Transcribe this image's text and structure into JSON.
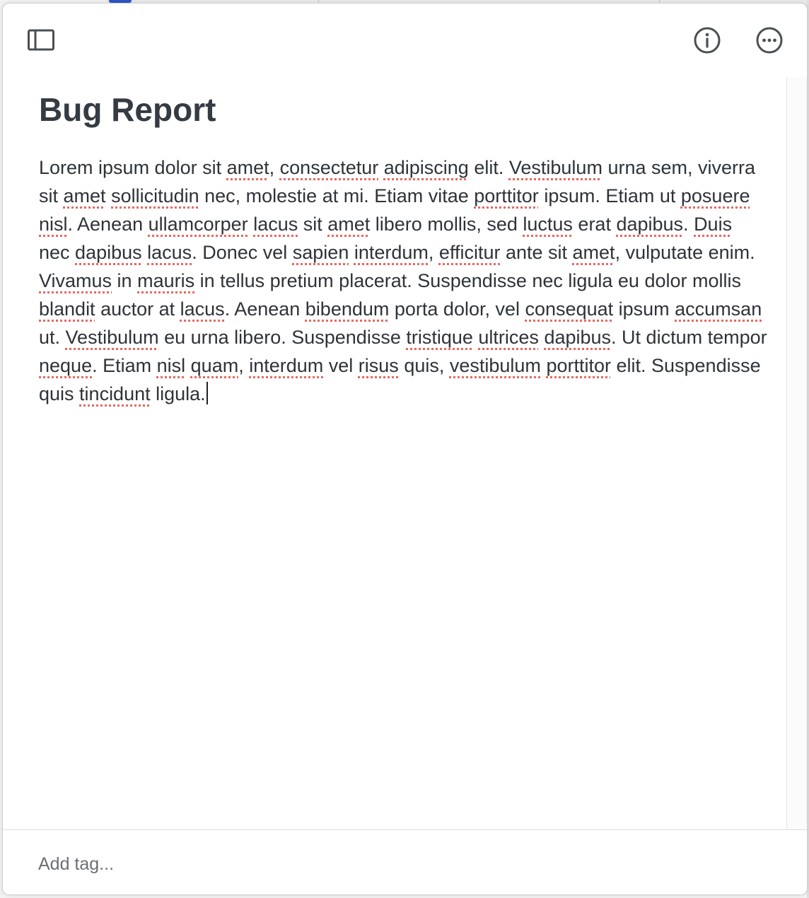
{
  "note": {
    "title": "Bug Report",
    "body_segments": [
      {
        "t": "Lorem ipsum dolor sit "
      },
      {
        "t": "amet",
        "s": true
      },
      {
        "t": ", "
      },
      {
        "t": "consectetur",
        "s": true
      },
      {
        "t": " "
      },
      {
        "t": "adipiscing",
        "s": true
      },
      {
        "t": " elit. "
      },
      {
        "t": "Vestibulum",
        "s": true
      },
      {
        "t": " urna sem, viverra sit "
      },
      {
        "t": "amet",
        "s": true
      },
      {
        "t": " "
      },
      {
        "t": "sollicitudin",
        "s": true
      },
      {
        "t": " nec, molestie at mi. Etiam vitae "
      },
      {
        "t": "porttitor",
        "s": true
      },
      {
        "t": " ipsum. Etiam ut "
      },
      {
        "t": "posuere",
        "s": true
      },
      {
        "t": " "
      },
      {
        "t": "nisl",
        "s": true
      },
      {
        "t": ". Aenean "
      },
      {
        "t": "ullamcorper",
        "s": true
      },
      {
        "t": " "
      },
      {
        "t": "lacus",
        "s": true
      },
      {
        "t": " sit "
      },
      {
        "t": "amet",
        "s": true
      },
      {
        "t": " libero mollis, sed "
      },
      {
        "t": "luctus",
        "s": true
      },
      {
        "t": " erat "
      },
      {
        "t": "dapibus",
        "s": true
      },
      {
        "t": ". "
      },
      {
        "t": "Duis",
        "s": true
      },
      {
        "t": " nec "
      },
      {
        "t": "dapibus",
        "s": true
      },
      {
        "t": " "
      },
      {
        "t": "lacus",
        "s": true
      },
      {
        "t": ". Donec vel "
      },
      {
        "t": "sapien",
        "s": true
      },
      {
        "t": " "
      },
      {
        "t": "interdum",
        "s": true
      },
      {
        "t": ", "
      },
      {
        "t": "efficitur",
        "s": true
      },
      {
        "t": " ante sit "
      },
      {
        "t": "amet",
        "s": true
      },
      {
        "t": ", vulputate enim. "
      },
      {
        "t": "Vivamus",
        "s": true
      },
      {
        "t": " in "
      },
      {
        "t": "mauris",
        "s": true
      },
      {
        "t": " in tellus pretium placerat. Suspendisse nec ligula eu dolor mollis "
      },
      {
        "t": "blandit",
        "s": true
      },
      {
        "t": " auctor at "
      },
      {
        "t": "lacus",
        "s": true
      },
      {
        "t": ". Aenean "
      },
      {
        "t": "bibendum",
        "s": true
      },
      {
        "t": " porta dolor, vel "
      },
      {
        "t": "consequat",
        "s": true
      },
      {
        "t": " ipsum "
      },
      {
        "t": "accumsan",
        "s": true
      },
      {
        "t": " ut. "
      },
      {
        "t": "Vestibulum",
        "s": true
      },
      {
        "t": " eu urna libero. Suspendisse "
      },
      {
        "t": "tristique",
        "s": true
      },
      {
        "t": " "
      },
      {
        "t": "ultrices",
        "s": true
      },
      {
        "t": " "
      },
      {
        "t": "dapibus",
        "s": true
      },
      {
        "t": ". Ut dictum tempor "
      },
      {
        "t": "neque",
        "s": true
      },
      {
        "t": ". Etiam "
      },
      {
        "t": "nisl",
        "s": true
      },
      {
        "t": " "
      },
      {
        "t": "quam",
        "s": true
      },
      {
        "t": ", "
      },
      {
        "t": "interdum",
        "s": true
      },
      {
        "t": " vel "
      },
      {
        "t": "risus",
        "s": true
      },
      {
        "t": " quis, "
      },
      {
        "t": "vestibulum",
        "s": true
      },
      {
        "t": " "
      },
      {
        "t": "porttitor",
        "s": true
      },
      {
        "t": " elit. Suspendisse quis "
      },
      {
        "t": "tincidunt",
        "s": true
      },
      {
        "t": " ligula."
      }
    ]
  },
  "toolbar": {
    "sidebar_icon": "sidebar-toggle-icon",
    "info_icon": "info-icon",
    "more_icon": "more-options-icon"
  },
  "footer": {
    "tag_placeholder": "Add tag..."
  },
  "colors": {
    "title": "#353b42",
    "body_text": "#2f3338",
    "spellcheck_underline": "#e8675f",
    "icon": "#4a4f55"
  }
}
